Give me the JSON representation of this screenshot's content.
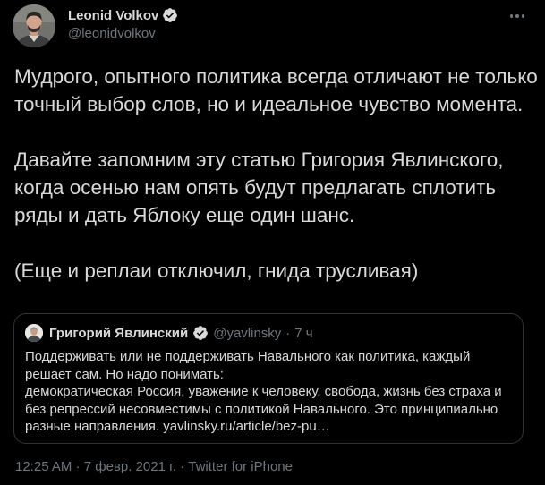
{
  "author": {
    "name": "Leonid Volkov",
    "handle": "@leonidvolkov",
    "verified": true
  },
  "tweet": {
    "paragraphs": [
      "Мудрого, опытного политика всегда отличают не только точный выбор слов, но и идеальное чувство момента.",
      "Давайте запомним эту статью Григория Явлинского, когда осенью нам опять будут предлагать сплотить ряды и дать Яблоку еще один шанс.",
      "(Еще и реплаи отключил, гнида трусливая)"
    ]
  },
  "quoted_tweet": {
    "author_name": "Григорий Явлинский",
    "handle": "@yavlinsky",
    "separator": "·",
    "time": "7 ч",
    "verified": true,
    "lines": [
      "Поддерживать или не поддерживать Навального как политика, каждый",
      "решает сам. Но надо понимать:",
      "демократическая Россия, уважение к человеку, свобода, жизнь без страха и",
      "без репрессий несовместимы с политикой Навального. Это принципиально",
      "разные направления. yavlinsky.ru/article/bez-pu…"
    ]
  },
  "meta": {
    "time": "12:25 AM",
    "separator": " · ",
    "date": "7 февр. 2021 г.",
    "source": "Twitter for iPhone"
  },
  "colors": {
    "background": "#000000",
    "text": "#d9d9d9",
    "secondary": "#6e767d",
    "verified": "#d9d9d9",
    "border": "#2f3336"
  },
  "icons": {
    "more": "ellipsis-icon",
    "verified": "verified-badge-icon"
  }
}
